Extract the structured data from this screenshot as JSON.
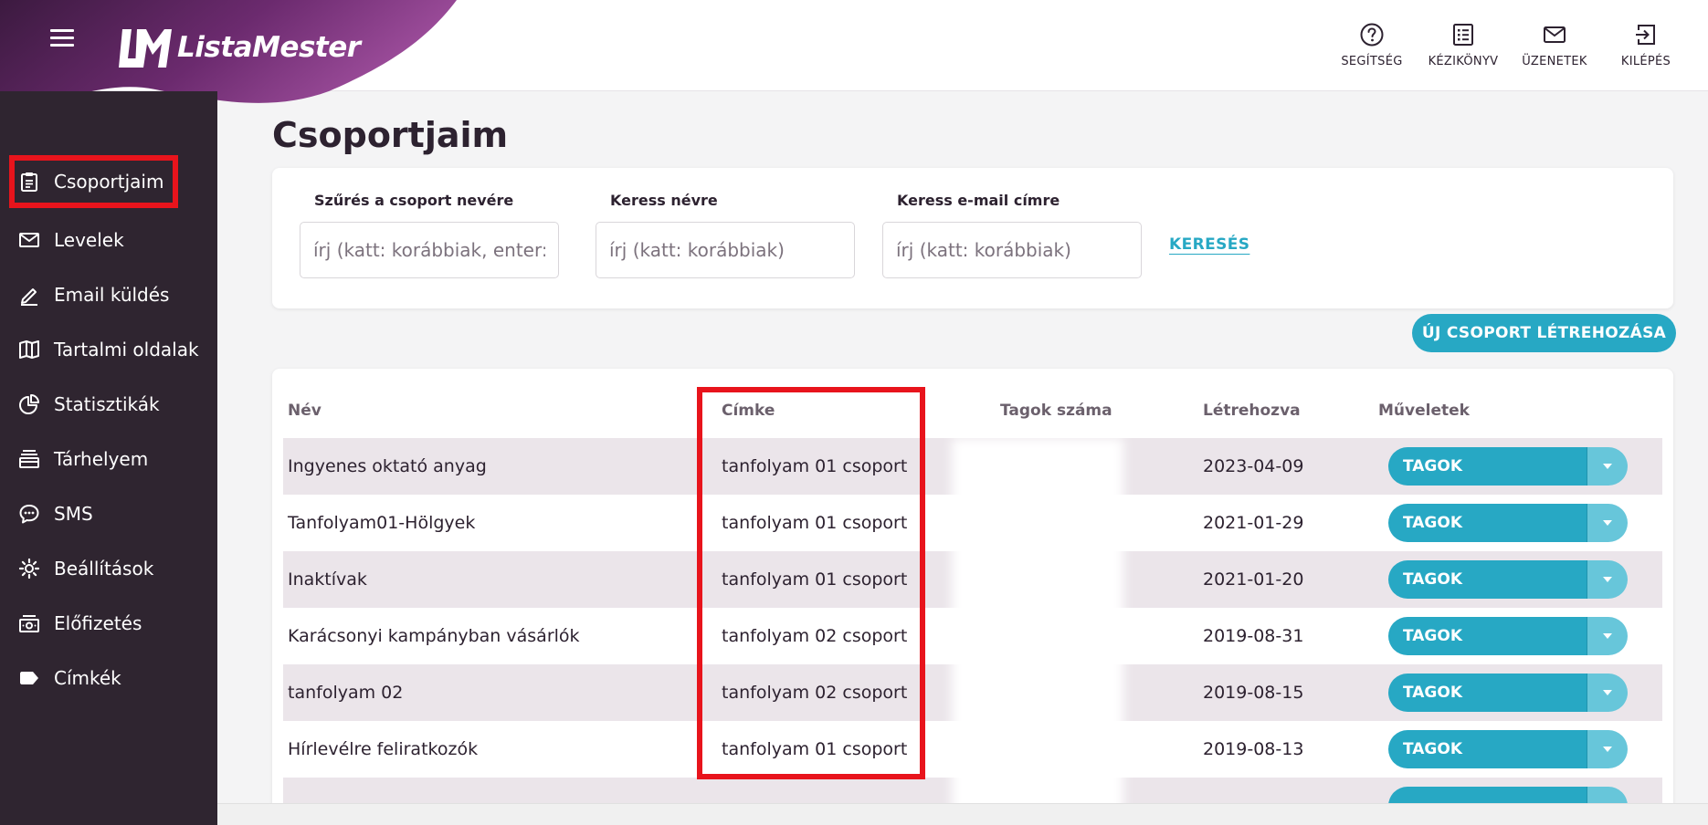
{
  "app": {
    "brand": "ListaMester"
  },
  "top_nav": [
    {
      "label": "SEGÍTSÉG",
      "icon": "help-circle-icon"
    },
    {
      "label": "KÉZIKÖNYV",
      "icon": "list-icon"
    },
    {
      "label": "ÜZENETEK",
      "icon": "envelope-icon"
    },
    {
      "label": "KILÉPÉS",
      "icon": "logout-icon"
    }
  ],
  "sidebar": {
    "items": [
      {
        "label": "Csoportjaim",
        "icon": "clipboard-icon",
        "active": true
      },
      {
        "label": "Levelek",
        "icon": "envelope-icon"
      },
      {
        "label": "Email küldés",
        "icon": "pen-icon"
      },
      {
        "label": "Tartalmi oldalak",
        "icon": "book-icon"
      },
      {
        "label": "Statisztikák",
        "icon": "pie-chart-icon"
      },
      {
        "label": "Tárhelyem",
        "icon": "storage-icon"
      },
      {
        "label": "SMS",
        "icon": "chat-bubble-icon"
      },
      {
        "label": "Beállítások",
        "icon": "gear-icon"
      },
      {
        "label": "Előfizetés",
        "icon": "money-icon"
      },
      {
        "label": "Címkék",
        "icon": "tag-icon"
      }
    ]
  },
  "main": {
    "title": "Csoportjaim",
    "filters": {
      "group_name": {
        "label": "Szűrés a csoport nevére",
        "placeholder": "írj (katt: korábbiak, enter: ...)"
      },
      "name": {
        "label": "Keress névre",
        "placeholder": "írj (katt: korábbiak)"
      },
      "email": {
        "label": "Keress e-mail címre",
        "placeholder": "írj (katt: korábbiak)"
      },
      "search_label": "KERESÉS"
    },
    "new_group_label": "ÚJ CSOPORT LÉTREHOZÁSA",
    "table": {
      "columns": [
        "Név",
        "Címke",
        "Tagok száma",
        "Létrehozva",
        "Műveletek"
      ],
      "action_label": "TAGOK",
      "rows": [
        {
          "name": "Ingyenes oktató anyag",
          "tag": "tanfolyam 01 csoport",
          "created": "2023-04-09"
        },
        {
          "name": "Tanfolyam01-Hölgyek",
          "tag": "tanfolyam 01 csoport",
          "created": "2021-01-29"
        },
        {
          "name": "Inaktívak",
          "tag": "tanfolyam 01 csoport",
          "created": "2021-01-20"
        },
        {
          "name": "Karácsonyi kampányban vásárlók",
          "tag": "tanfolyam 02 csoport",
          "created": "2019-08-31"
        },
        {
          "name": "tanfolyam 02",
          "tag": "tanfolyam 02 csoport",
          "created": "2019-08-15"
        },
        {
          "name": "Hírlevélre feliratkozók",
          "tag": "tanfolyam 01 csoport",
          "created": "2019-08-13"
        }
      ]
    }
  },
  "colors": {
    "accent": "#27a8c4",
    "sidebar_bg": "#2f2530",
    "brand_purple": "#6b2a6e",
    "highlight": "#e8141c"
  }
}
